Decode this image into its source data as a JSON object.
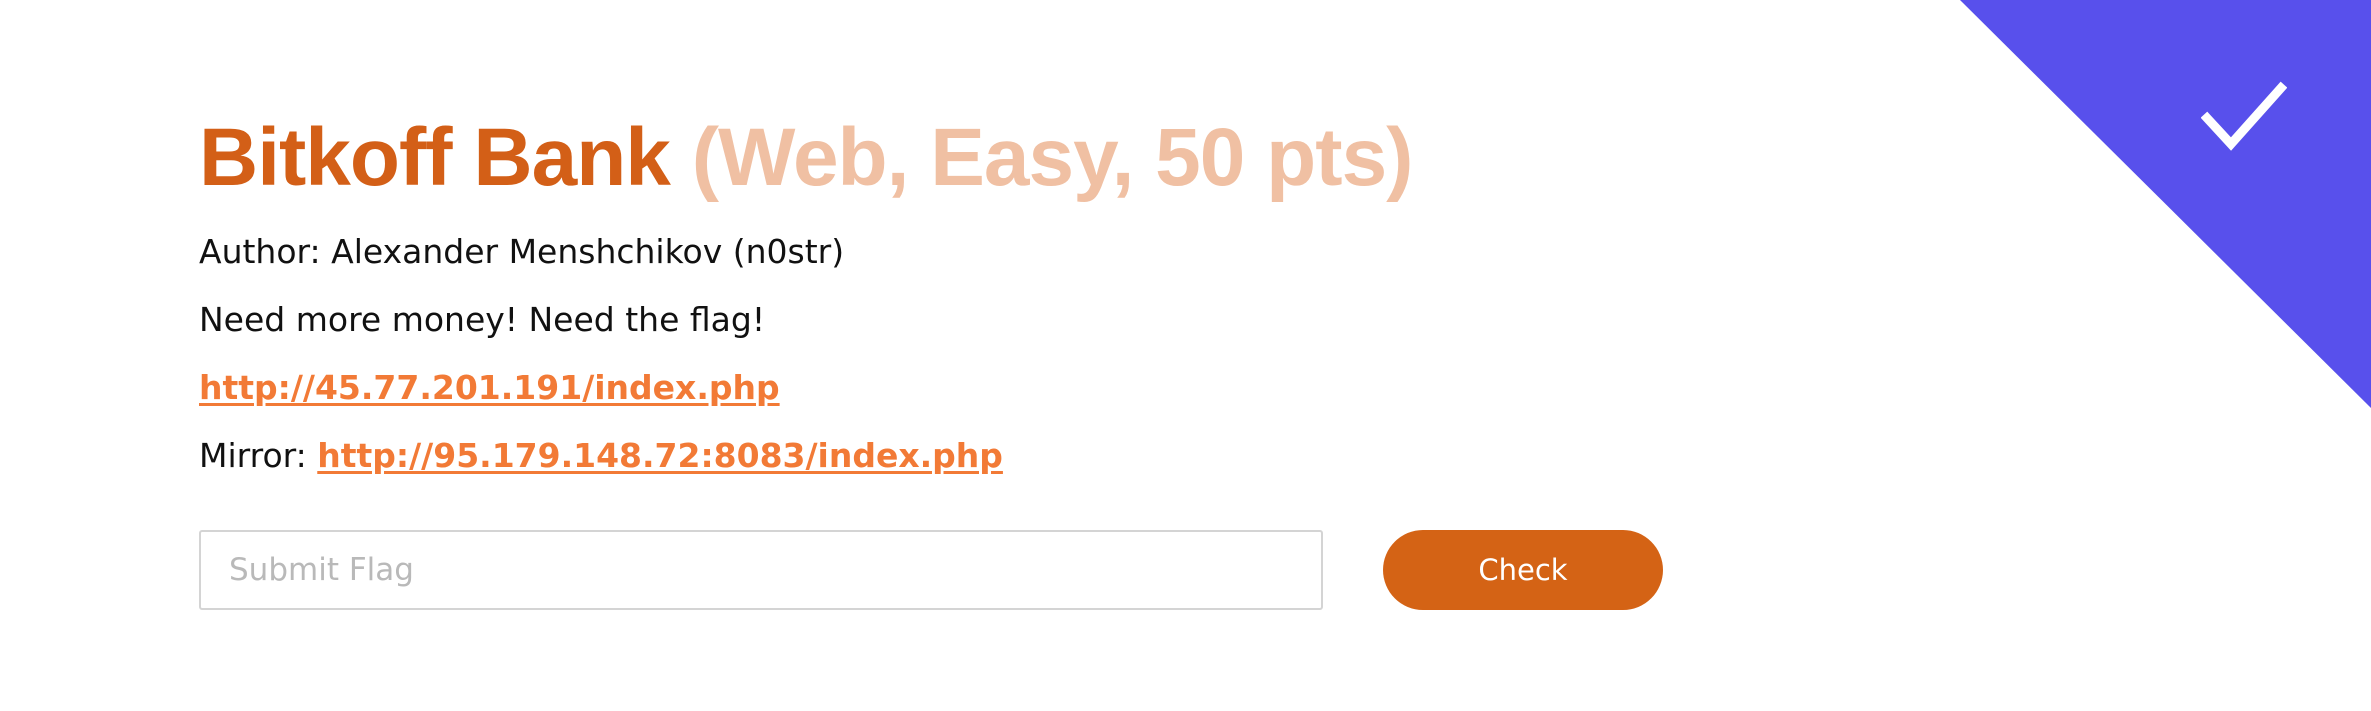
{
  "challenge": {
    "name": "Bitkoff Bank",
    "meta": "(Web, Easy, 50 pts)",
    "author_line": "Author: Alexander Menshchikov (n0str)",
    "description": "Need more money! Need the flag!",
    "link": "http://45.77.201.191/index.php",
    "mirror_label": "Mirror:",
    "mirror_link": "http://95.179.148.72:8083/index.php"
  },
  "form": {
    "flag_placeholder": "Submit Flag",
    "flag_value": "",
    "check_label": "Check"
  },
  "status": {
    "solved": true,
    "icon": "check-icon",
    "corner_color": "#5850ec"
  },
  "colors": {
    "title": "#d35f17",
    "title_meta": "#f0c0a3",
    "link": "#f27a36",
    "button": "#d46315"
  }
}
